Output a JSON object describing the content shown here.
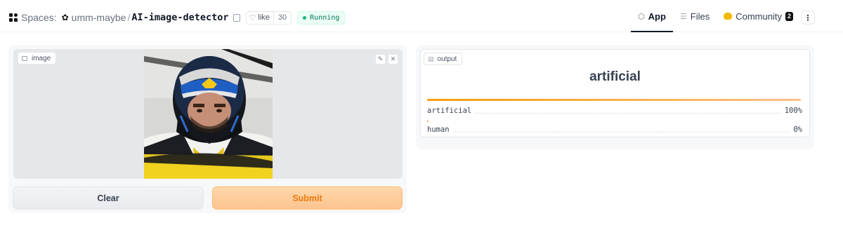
{
  "header": {
    "spaces_label": "Spaces:",
    "org_name": "umm-maybe",
    "separator": "/",
    "space_name": "AI-image-detector",
    "like_label": "like",
    "like_count": "30",
    "status": "Running",
    "status_color": "#10b981"
  },
  "nav": {
    "tabs": [
      {
        "label": "App",
        "icon": "cube-icon",
        "active": true
      },
      {
        "label": "Files",
        "icon": "files-icon",
        "active": false
      },
      {
        "label": "Community",
        "icon": "community-icon",
        "active": false,
        "badge": "2"
      }
    ],
    "menu_icon": "more-vertical-icon"
  },
  "input_panel": {
    "image_label": "image",
    "clear_label": "Clear",
    "submit_label": "Submit",
    "accent_color": "#ea7c0c"
  },
  "output_panel": {
    "output_label": "output",
    "top_label": "artificial",
    "confidences": [
      {
        "label": "artificial",
        "value": "100%",
        "fraction": 1.0
      },
      {
        "label": "human",
        "value": "0%",
        "fraction": 0.0
      }
    ]
  }
}
